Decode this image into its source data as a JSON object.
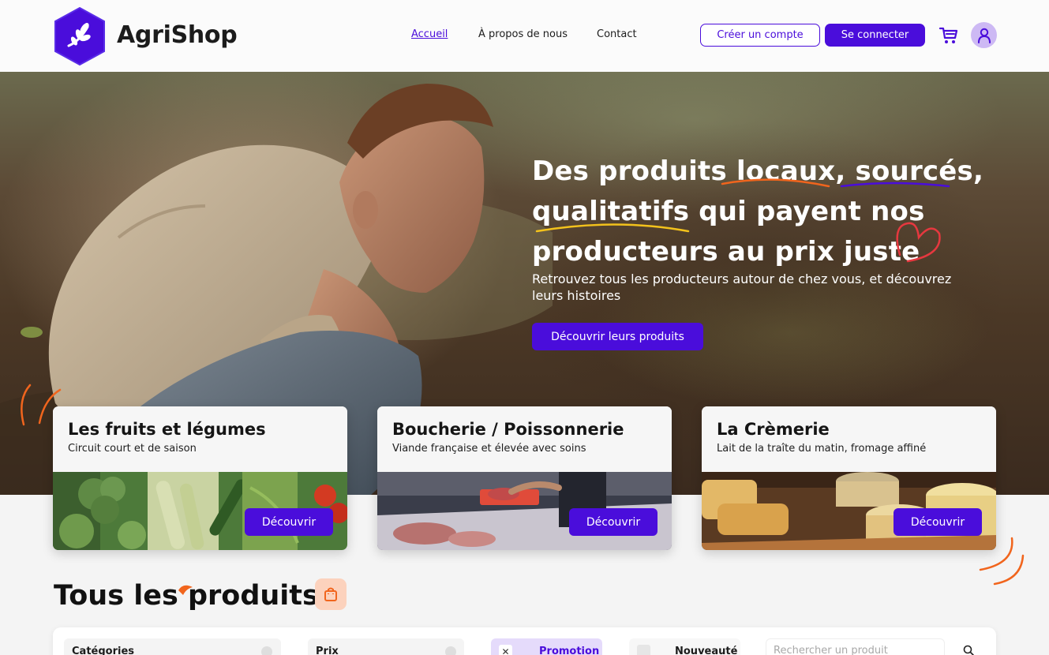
{
  "brand": {
    "name": "AgriShop",
    "accent": "#4a0ddb",
    "logo_icon": "leaf-hexagon-icon"
  },
  "nav": {
    "links": [
      {
        "label": "Accueil",
        "active": true
      },
      {
        "label": "À propos de nous",
        "active": false
      },
      {
        "label": "Contact",
        "active": false
      }
    ],
    "create_account": "Créer un compte",
    "login": "Se connecter",
    "cart_icon": "cart-icon",
    "user_icon": "user-icon"
  },
  "hero": {
    "title_lines": [
      "Des produits locaux, sourcés,",
      "qualitatifs qui payent nos",
      "producteurs au prix juste"
    ],
    "subtitle": "Retrouvez tous les producteurs autour de chez vous, et découvrez leurs histoires",
    "cta": "Découvrir leurs produits",
    "highlight_colors": {
      "locaux": "#f1651d",
      "sources": "#4a0ddb",
      "qualitatifs": "#f3c21c",
      "heart": "#e6383f"
    }
  },
  "categories": [
    {
      "title": "Les fruits et légumes",
      "subtitle": "Circuit court et de saison",
      "button": "Découvrir"
    },
    {
      "title": "Boucherie / Poissonnerie",
      "subtitle": "Viande française et élevée avec soins",
      "button": "Découvrir"
    },
    {
      "title": "La Crèmerie",
      "subtitle": "Lait de la traîte du matin, fromage affiné",
      "button": "Découvrir"
    }
  ],
  "products": {
    "title": "Tous les produits",
    "badge_icon": "shopping-bag-icon",
    "filters": {
      "categories_label": "Catégories",
      "price_label": "Prix",
      "promotion_label": "Promotion",
      "promotion_checked": true,
      "new_label": "Nouveauté",
      "new_checked": false,
      "search_placeholder": "Rechercher un produit",
      "search_icon": "search-icon"
    }
  }
}
